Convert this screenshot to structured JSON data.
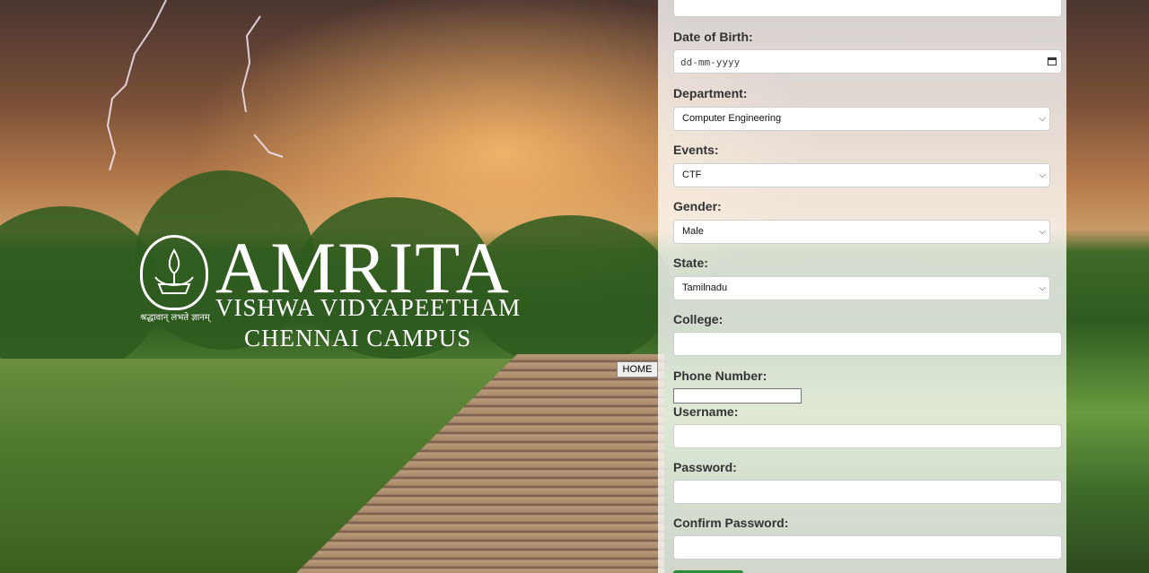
{
  "logo": {
    "brand": "AMRITA",
    "subtitle": "VISHWA VIDYAPEETHAM",
    "campus": "CHENNAI CAMPUS",
    "motto": "श्रद्धावान् लभते ज्ञानम्"
  },
  "home_button": "HOME",
  "form": {
    "dob_label": "Date of Birth:",
    "dob_placeholder": "dd-mm-yyyy",
    "department_label": "Department:",
    "department_value": "Computer Engineering",
    "events_label": "Events:",
    "events_value": "CTF",
    "gender_label": "Gender:",
    "gender_value": "Male",
    "state_label": "State:",
    "state_value": "Tamilnadu",
    "college_label": "College:",
    "college_value": "",
    "phone_label": "Phone Number:",
    "phone_value": "",
    "username_label": "Username:",
    "username_value": "",
    "password_label": "Password:",
    "password_value": "",
    "confirm_label": "Confirm Password:",
    "confirm_value": ""
  },
  "colors": {
    "submit": "#2e8b3a",
    "panel": "#ffffffc7"
  }
}
